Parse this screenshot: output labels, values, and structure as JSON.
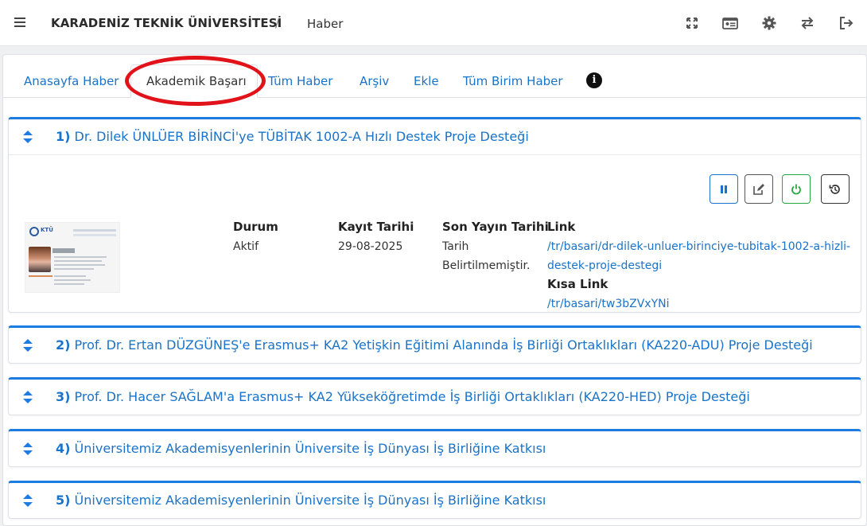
{
  "header": {
    "org_name": "KARADENİZ TEKNİK ÜNİVERSİTESİ",
    "separator": "/",
    "breadcrumb": "Haber",
    "icons": [
      "fullscreen-icon",
      "id-card-icon",
      "gear-icon",
      "switch-icon",
      "logout-icon"
    ]
  },
  "tabs": [
    {
      "label": "Anasayfa Haber"
    },
    {
      "label": "Akademik Başarı",
      "active": true
    },
    {
      "label": "Tüm Haber"
    },
    {
      "label": "Arşiv"
    },
    {
      "label": "Ekle"
    },
    {
      "label": "Tüm Birim Haber"
    }
  ],
  "info_icon_glyph": "i",
  "items": [
    {
      "number": "1)",
      "title": "Dr. Dilek ÜNLÜER BİRİNCİ'ye TÜBİTAK 1002-A Hızlı Destek Proje Desteği",
      "expanded": true,
      "thumbnail": {
        "logo_text": "KTÜ"
      },
      "durum_label": "Durum",
      "durum_value": "Aktif",
      "kayit_label": "Kayıt Tarihi",
      "kayit_value": "29-08-2025",
      "yayin_label": "Son Yayın Tarihi",
      "yayin_value_1": "Tarih",
      "yayin_value_2": "Belirtilmemiştir.",
      "link_label": "Link",
      "link_value_1": "/tr/basari/dr-dilek-unluer-birinciye-tubitak-1002-a-hizli-",
      "link_value_2": "destek-proje-destegi",
      "short_link_label": "Kısa Link",
      "short_link_value": "/tr/basari/tw3bZVxYNi"
    },
    {
      "number": "2)",
      "title": "Prof. Dr. Ertan DÜZGÜNEŞ'e Erasmus+ KA2 Yetişkin Eğitimi Alanında İş Birliği Ortaklıkları (KA220-ADU) Proje Desteği"
    },
    {
      "number": "3)",
      "title": "Prof. Dr. Hacer SAĞLAM'a Erasmus+ KA2 Yükseköğretimde İş Birliği Ortaklıkları (KA220-HED) Proje Desteği"
    },
    {
      "number": "4)",
      "title": "Üniversitemiz Akademisyenlerinin Üniversite İş Dünyası İş Birliğine Katkısı"
    },
    {
      "number": "5)",
      "title": "Üniversitemiz Akademisyenlerinin Üniversite İş Dünyası İş Birliğine Katkısı"
    }
  ],
  "colors": {
    "accent": "#1a73c8",
    "accordion_border": "#1e7be0",
    "highlight": "#e2121a",
    "power_green": "#28a745"
  }
}
